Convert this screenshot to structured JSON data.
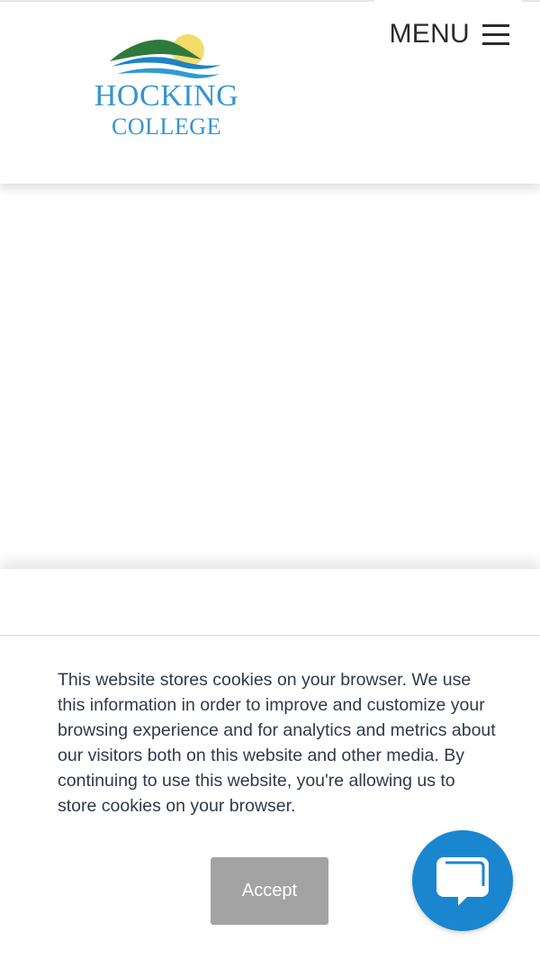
{
  "header": {
    "logo": {
      "name": "HOCKING",
      "sub": "COLLEGE"
    },
    "menu_label": "MENU"
  },
  "cookie_banner": {
    "text": "This website stores cookies on your browser. We use this information in order to improve and customize your browsing experience and for analytics and metrics about our visitors both on this website and other media. By continuing to use this website, you're allowing us to store cookies on your browser.",
    "accept_label": "Accept"
  },
  "icons": {
    "menu": "hamburger-icon",
    "chat": "chat-bubble-icon"
  },
  "colors": {
    "brand_blue": "#3594cf",
    "chat_blue": "#1a86d0",
    "accept_gray": "#a3a3a3",
    "logo_green": "#2e7a3b",
    "logo_sun": "#f4dc6c"
  }
}
